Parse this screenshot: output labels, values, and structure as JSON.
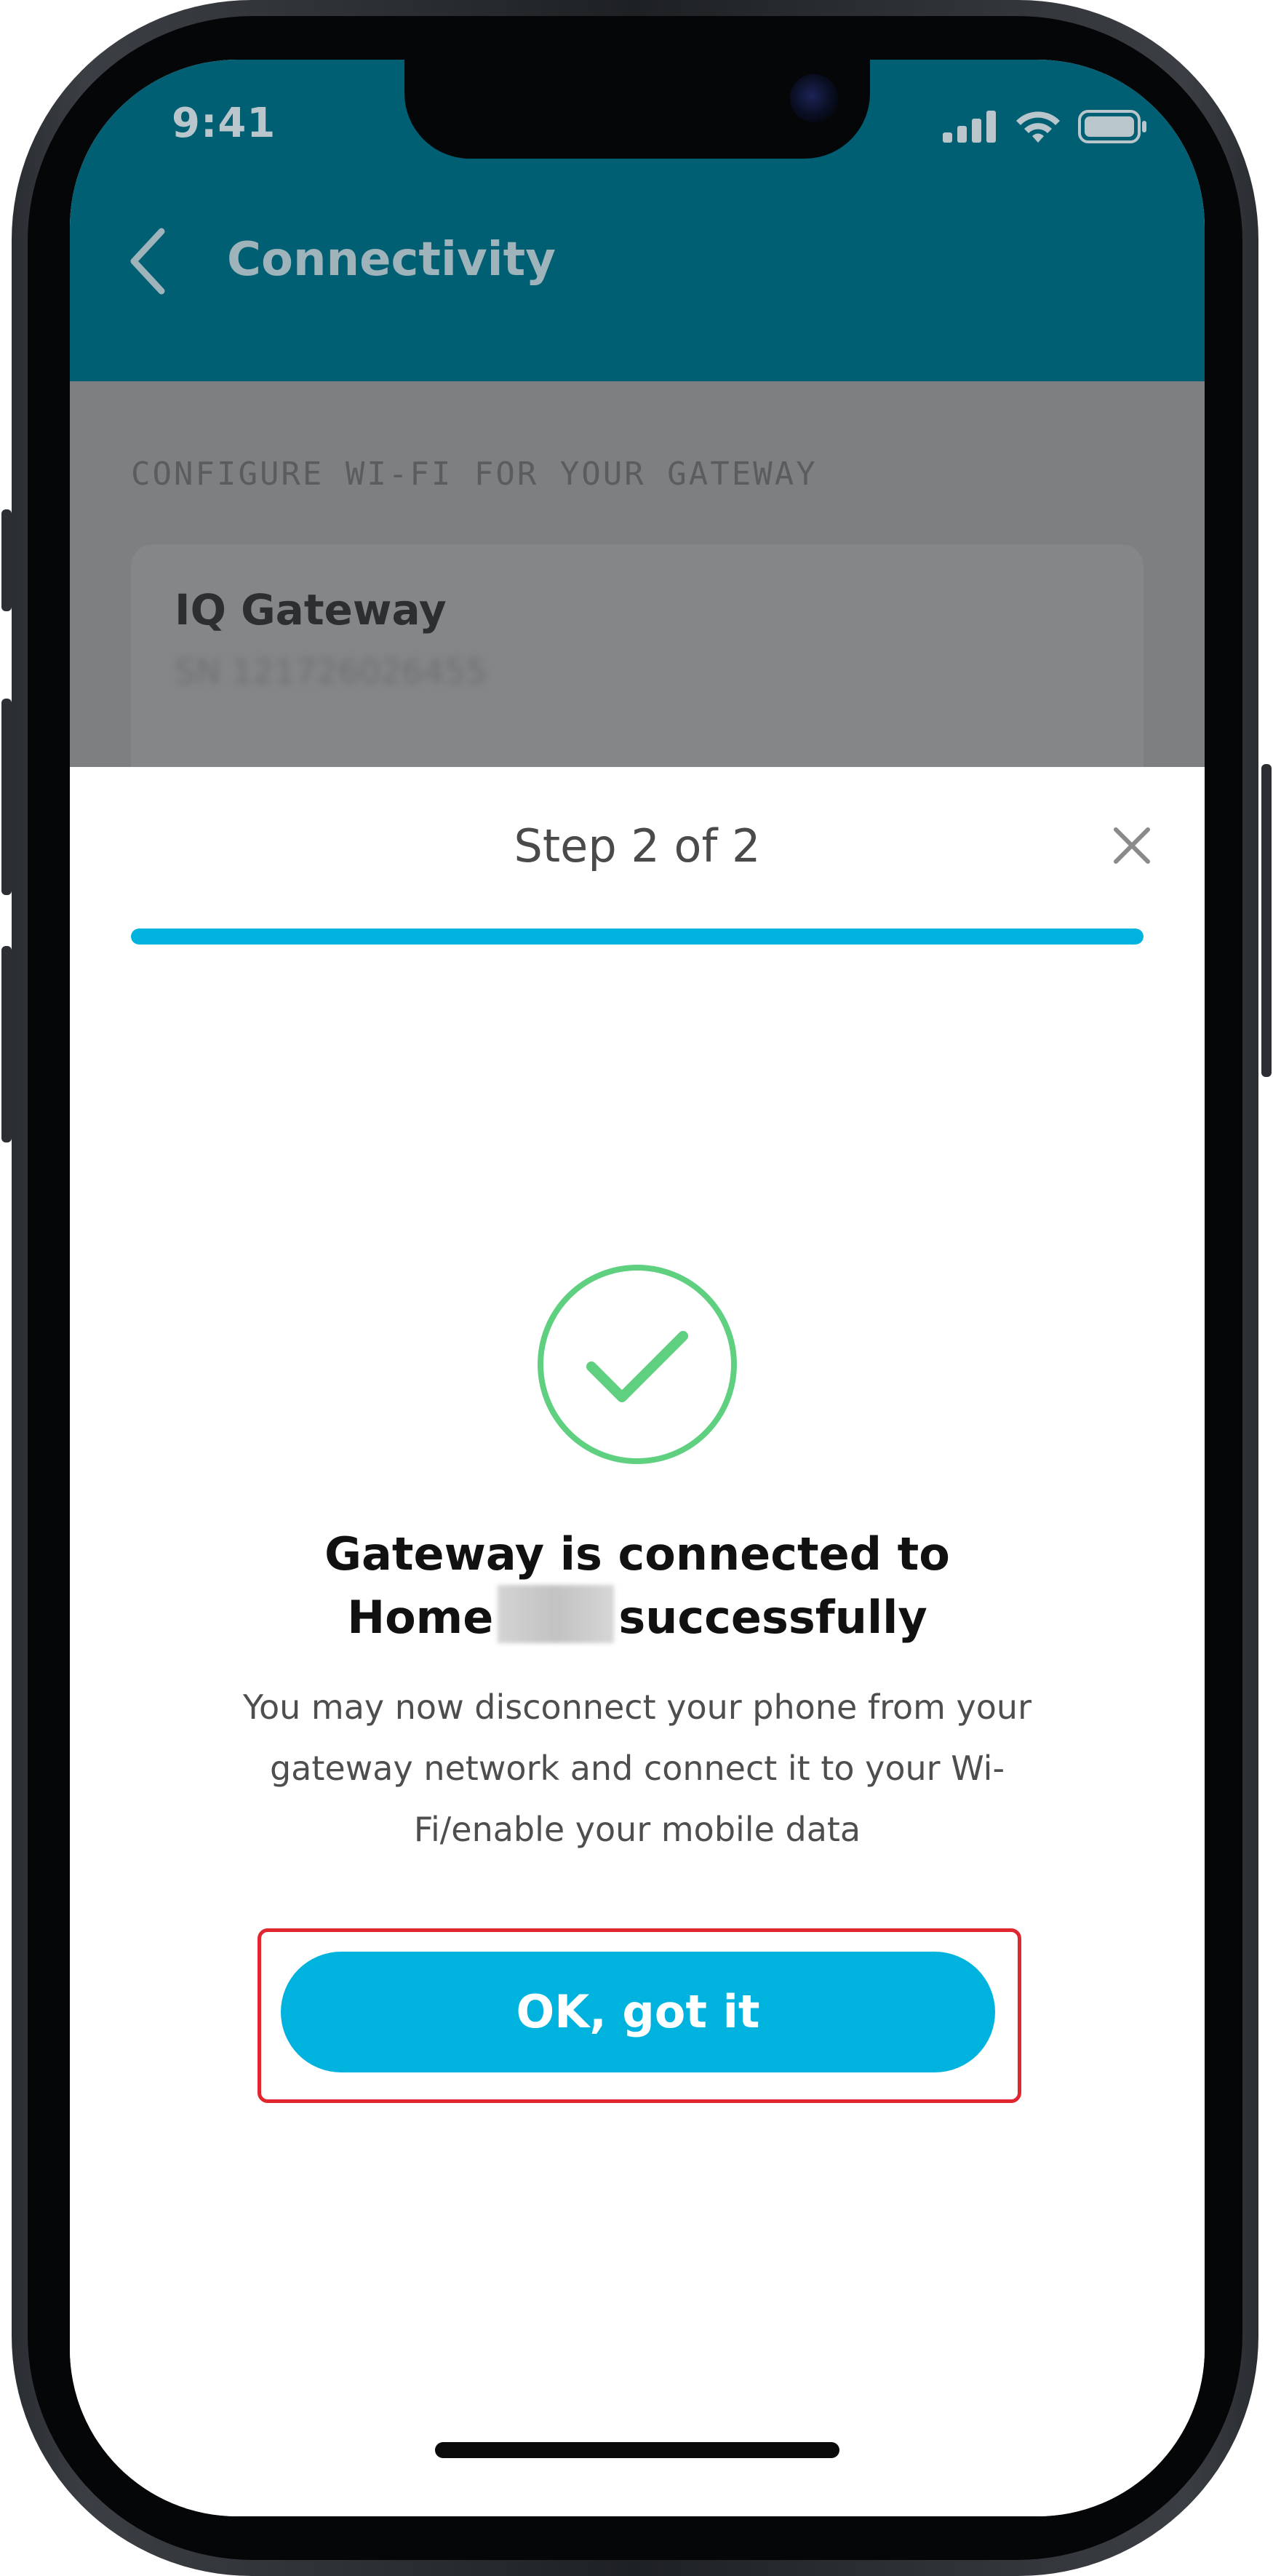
{
  "status_bar": {
    "time": "9:41"
  },
  "app_bar": {
    "title": "Connectivity",
    "back_icon": "chevron-left-icon"
  },
  "background_content": {
    "section_label": "CONFIGURE WI-FI FOR YOUR GATEWAY",
    "gateway_card": {
      "name": "IQ Gateway",
      "serial": "SN 121726026455"
    }
  },
  "sheet": {
    "step_label": "Step 2 of 2",
    "progress_fraction": 1.0,
    "close_icon": "close-icon",
    "success_icon": "check-circle-icon",
    "title_line1": "Gateway is connected to",
    "title_line2_prefix": "Home",
    "title_line2_suffix": "successfully",
    "body": "You may now disconnect your phone from your gateway network and connect it to your Wi-Fi/enable your mobile data",
    "ok_button_label": "OK, got it"
  },
  "colors": {
    "app_bar": "#005f73",
    "accent": "#00b3de",
    "success_green": "#5fcf80",
    "highlight_red": "#e0262e"
  }
}
